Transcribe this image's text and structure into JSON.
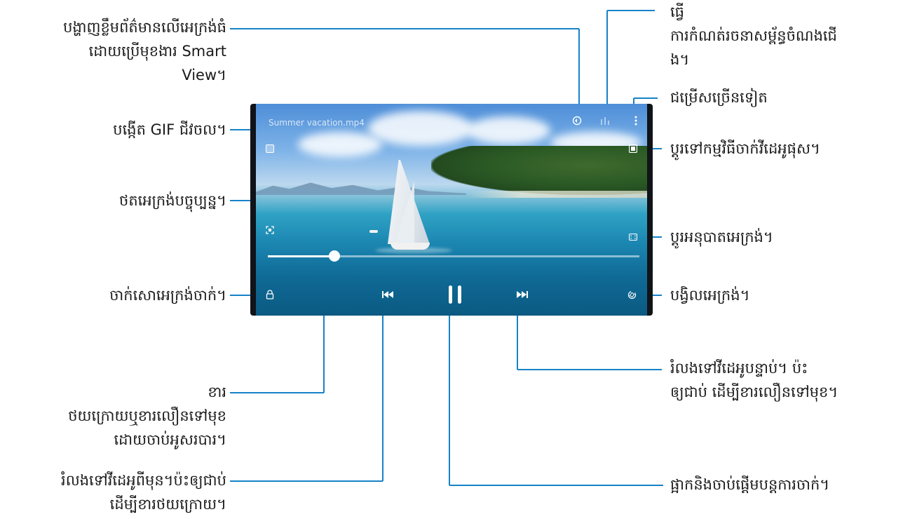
{
  "video": {
    "title": "Summer vacation.mp4",
    "current_time": "",
    "total_time": "",
    "progress": 0.18
  },
  "callouts": {
    "smart_view": "បង្ហាញខ្លឹមព័ត៌មានលើអេក្រង់ធំ\nដោយប្រើមុខងារ Smart\nView។",
    "equalizer": "ធ្វើ\nការកំណត់រចនាសម្ព័ន្ធចំណងជើ\nង។",
    "more_options": "ជម្រើសច្រើនទៀត",
    "gif": "បង្កើត GIF ជីវចល។",
    "popup": "ប្ដូរទៅកម្មវិធីចាក់វីដេអូផុស។",
    "capture": "ថតអេក្រង់បច្ចុប្បន្ន។",
    "ratio": "ប្ដូរអនុបាតអេក្រង់។",
    "lock": "ចាក់សោអេក្រង់ចាក់។",
    "rotate": "បង្វិលអេក្រង់។",
    "next": "រំលងទៅវីដេអូបន្ទាប់។ ប៉ះ\nឲ្យជាប់ ដើម្បីខារលឿនទៅមុខ។",
    "scrub": "ខារ\nថយក្រោយឬខារលឿនទៅមុខ\nដោយចាប់អូសរបារ។",
    "previous": "រំលងទៅវីដេអូពីមុន។ប៉ះឲ្យជាប់\nដើម្បីខារថយក្រោយ។",
    "pause": "ផ្អាកនិងចាប់ផ្ដើមបន្តការចាក់។"
  },
  "icons": {
    "smart_view": "smart-view-icon",
    "equalizer": "equalizer-icon",
    "more": "more-options-icon",
    "gif": "gif-icon",
    "popup": "popup-player-icon",
    "capture": "capture-icon",
    "ratio": "aspect-ratio-icon",
    "lock": "lock-icon",
    "rotate": "rotate-icon",
    "previous": "skip-previous-icon",
    "pause": "pause-icon",
    "next": "skip-next-icon"
  },
  "colors": {
    "leader": "#1683c8",
    "text": "#1a1a1a",
    "control": "#ffffff"
  }
}
